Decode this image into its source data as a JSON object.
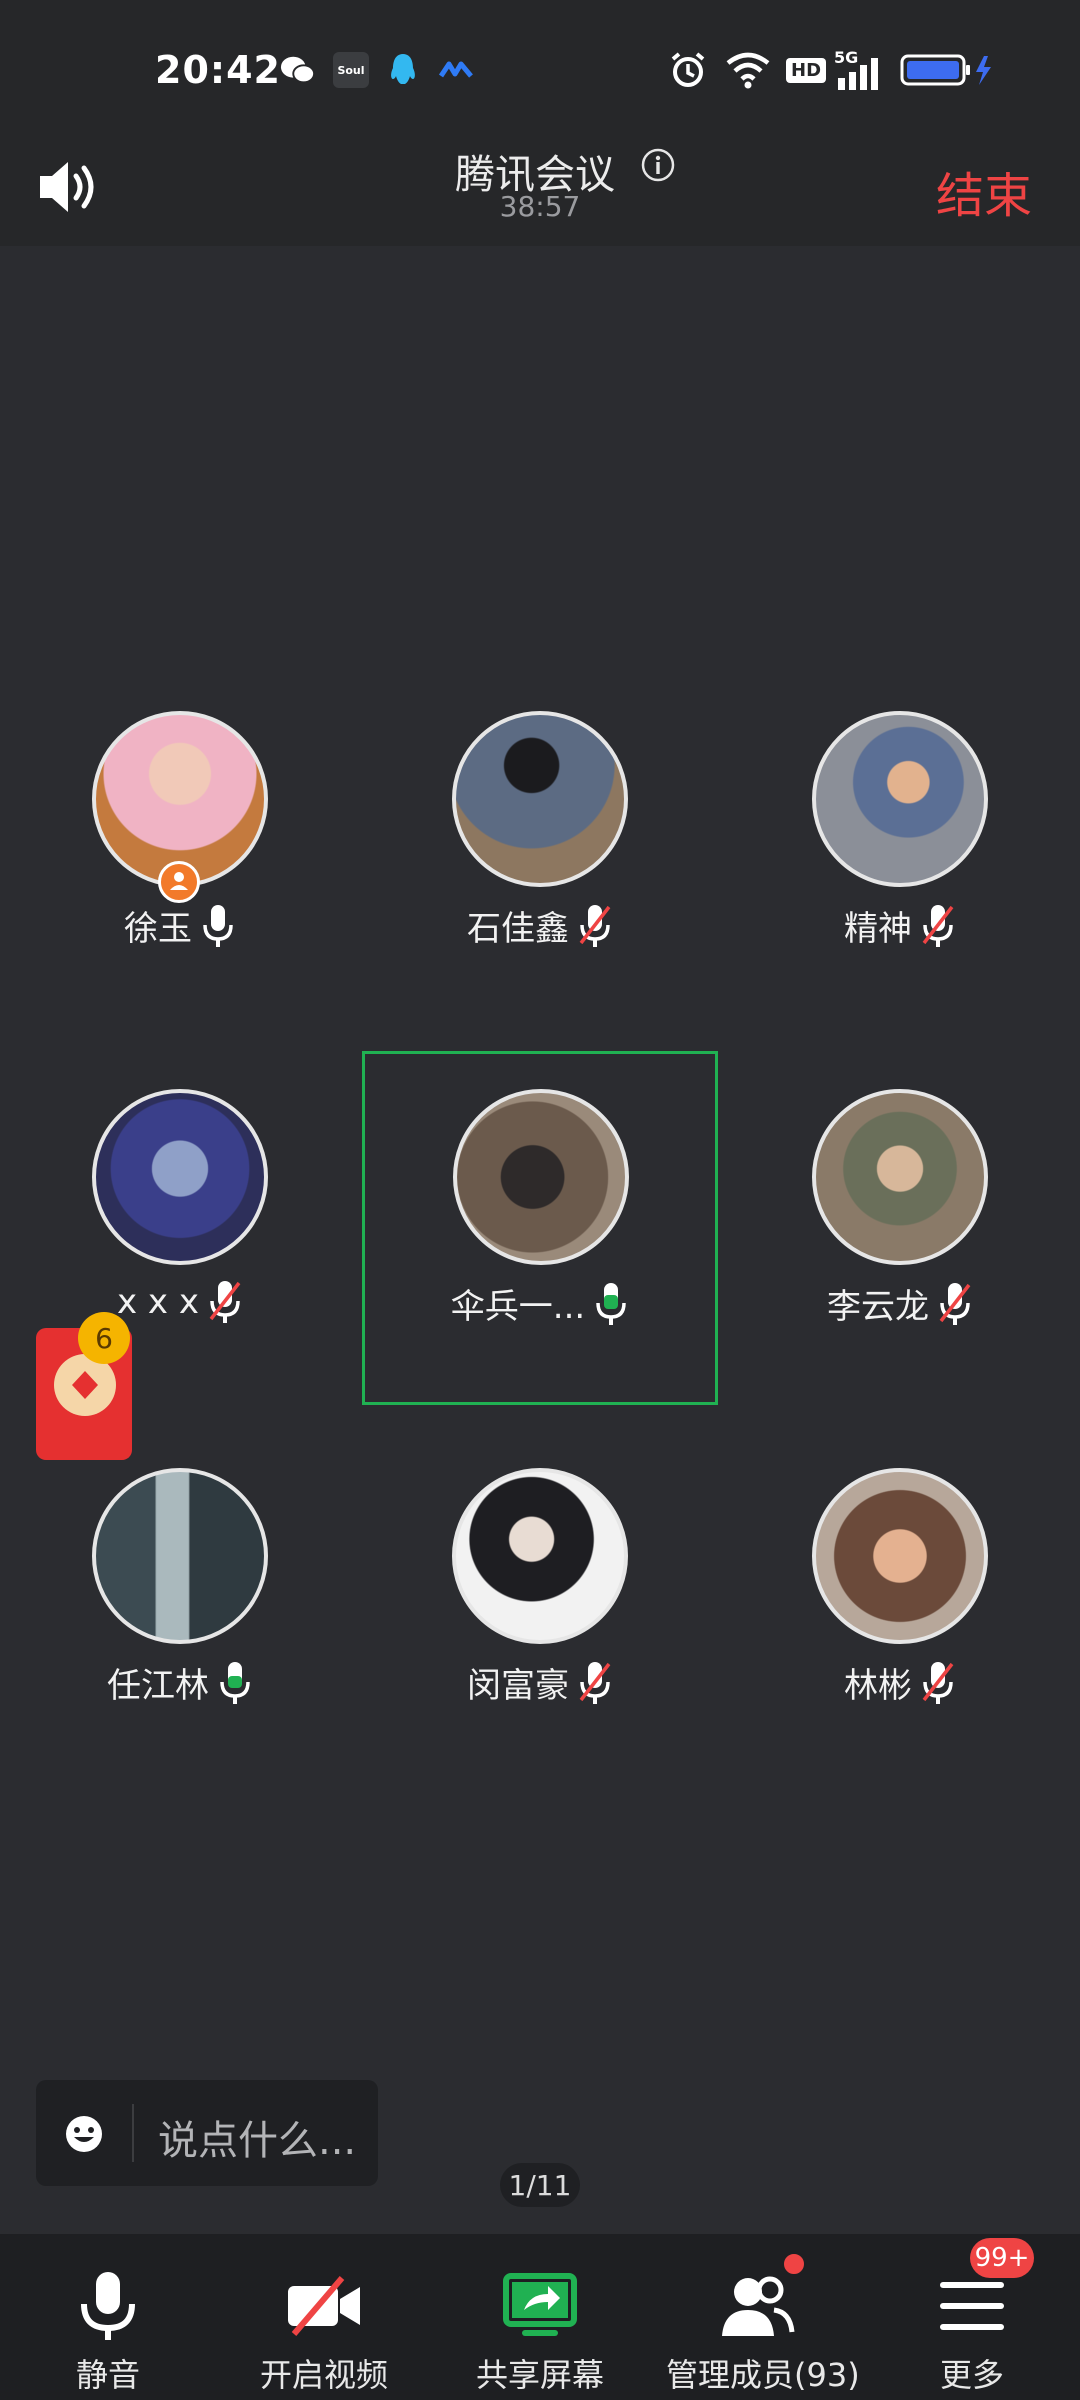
{
  "status_bar": {
    "time": "20:42",
    "apps": [
      "wechat-icon",
      "soul-app-icon",
      "qq-icon",
      "app-icon"
    ],
    "soul_text": "Soul",
    "hd_text": "HD",
    "network_text": "5G"
  },
  "header": {
    "title": "腾讯会议",
    "timer": "38:57",
    "end_label": "结束"
  },
  "participants": [
    {
      "name": "徐玉",
      "mic": "on",
      "host": true
    },
    {
      "name": "石佳鑫",
      "mic": "off"
    },
    {
      "name": "精神",
      "mic": "off"
    },
    {
      "name": "x x x",
      "mic": "off"
    },
    {
      "name": "伞兵一...",
      "mic": "speaking",
      "active": true
    },
    {
      "name": "李云龙",
      "mic": "off"
    },
    {
      "name": "任江林",
      "mic": "speaking"
    },
    {
      "name": "闵富豪",
      "mic": "off"
    },
    {
      "name": "林彬",
      "mic": "off"
    }
  ],
  "red_packet": {
    "badge": "6"
  },
  "chat": {
    "placeholder": "说点什么..."
  },
  "page_indicator": "1/11",
  "toolbar": {
    "mute_label": "静音",
    "video_label": "开启视频",
    "share_label": "共享屏幕",
    "members_label": "管理成员(93)",
    "more_label": "更多",
    "more_badge": "99+"
  },
  "colors": {
    "accent_green": "#20b152",
    "danger_red": "#ef4444",
    "background": "#2b2c30"
  }
}
